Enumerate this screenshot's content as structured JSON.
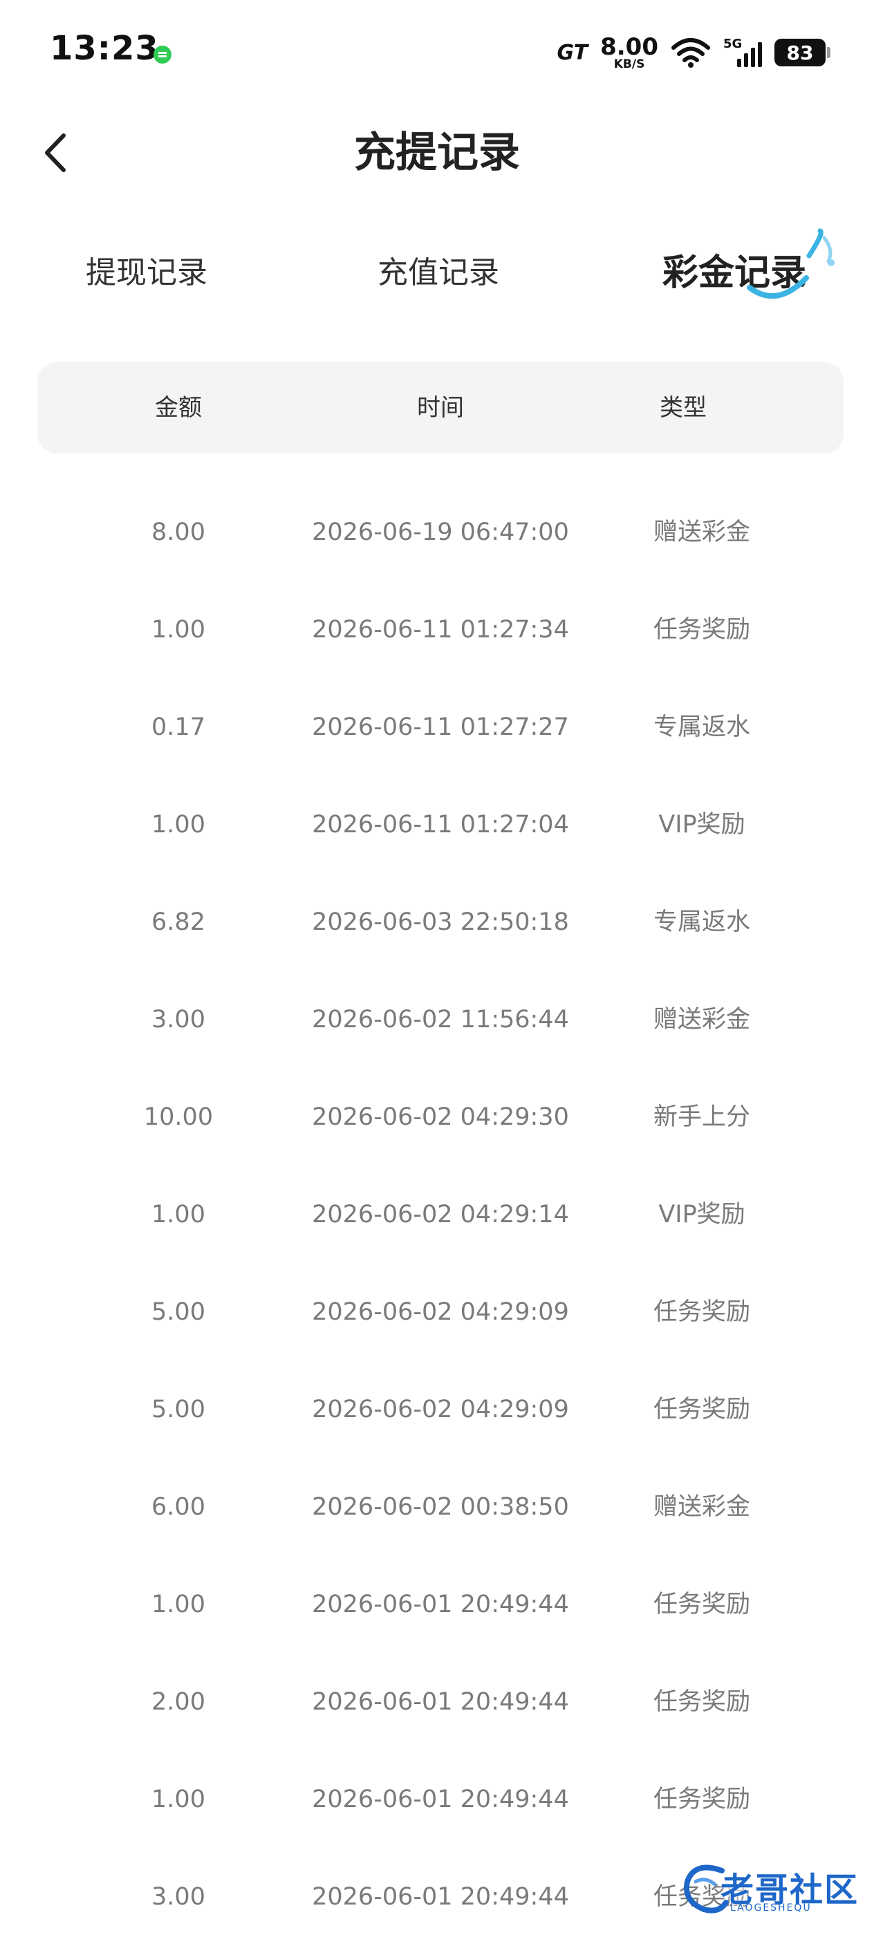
{
  "status_bar": {
    "time": "13:23",
    "network_brand": "GT",
    "speed_value": "8.00",
    "speed_unit": "KB/S",
    "network_type": "5G",
    "battery": "83"
  },
  "header": {
    "title": "充提记录",
    "back_icon": "chevron-left-icon"
  },
  "tabs": [
    {
      "label": "提现记录",
      "active": false
    },
    {
      "label": "充值记录",
      "active": false
    },
    {
      "label": "彩金记录",
      "active": true
    }
  ],
  "table": {
    "columns": [
      "金额",
      "时间",
      "类型"
    ],
    "rows": [
      {
        "amount": "8.00",
        "time": "2026-06-19 06:47:00",
        "type": "赠送彩金"
      },
      {
        "amount": "1.00",
        "time": "2026-06-11 01:27:34",
        "type": "任务奖励"
      },
      {
        "amount": "0.17",
        "time": "2026-06-11 01:27:27",
        "type": "专属返水"
      },
      {
        "amount": "1.00",
        "time": "2026-06-11 01:27:04",
        "type": "VIP奖励"
      },
      {
        "amount": "6.82",
        "time": "2026-06-03 22:50:18",
        "type": "专属返水"
      },
      {
        "amount": "3.00",
        "time": "2026-06-02 11:56:44",
        "type": "赠送彩金"
      },
      {
        "amount": "10.00",
        "time": "2026-06-02 04:29:30",
        "type": "新手上分"
      },
      {
        "amount": "1.00",
        "time": "2026-06-02 04:29:14",
        "type": "VIP奖励"
      },
      {
        "amount": "5.00",
        "time": "2026-06-02 04:29:09",
        "type": "任务奖励"
      },
      {
        "amount": "5.00",
        "time": "2026-06-02 04:29:09",
        "type": "任务奖励"
      },
      {
        "amount": "6.00",
        "time": "2026-06-02 00:38:50",
        "type": "赠送彩金"
      },
      {
        "amount": "1.00",
        "time": "2026-06-01 20:49:44",
        "type": "任务奖励"
      },
      {
        "amount": "2.00",
        "time": "2026-06-01 20:49:44",
        "type": "任务奖励"
      },
      {
        "amount": "1.00",
        "time": "2026-06-01 20:49:44",
        "type": "任务奖励"
      },
      {
        "amount": "3.00",
        "time": "2026-06-01 20:49:44",
        "type": "任务奖励"
      }
    ]
  },
  "watermark": {
    "text": "老哥社区",
    "subtext": "LAOGESHEQU"
  },
  "colors": {
    "tab_accent": "#3bb3e3",
    "header_bg": "#f4f4f4",
    "row_text": "#7a7a7a",
    "watermark": "#1e67c9"
  }
}
